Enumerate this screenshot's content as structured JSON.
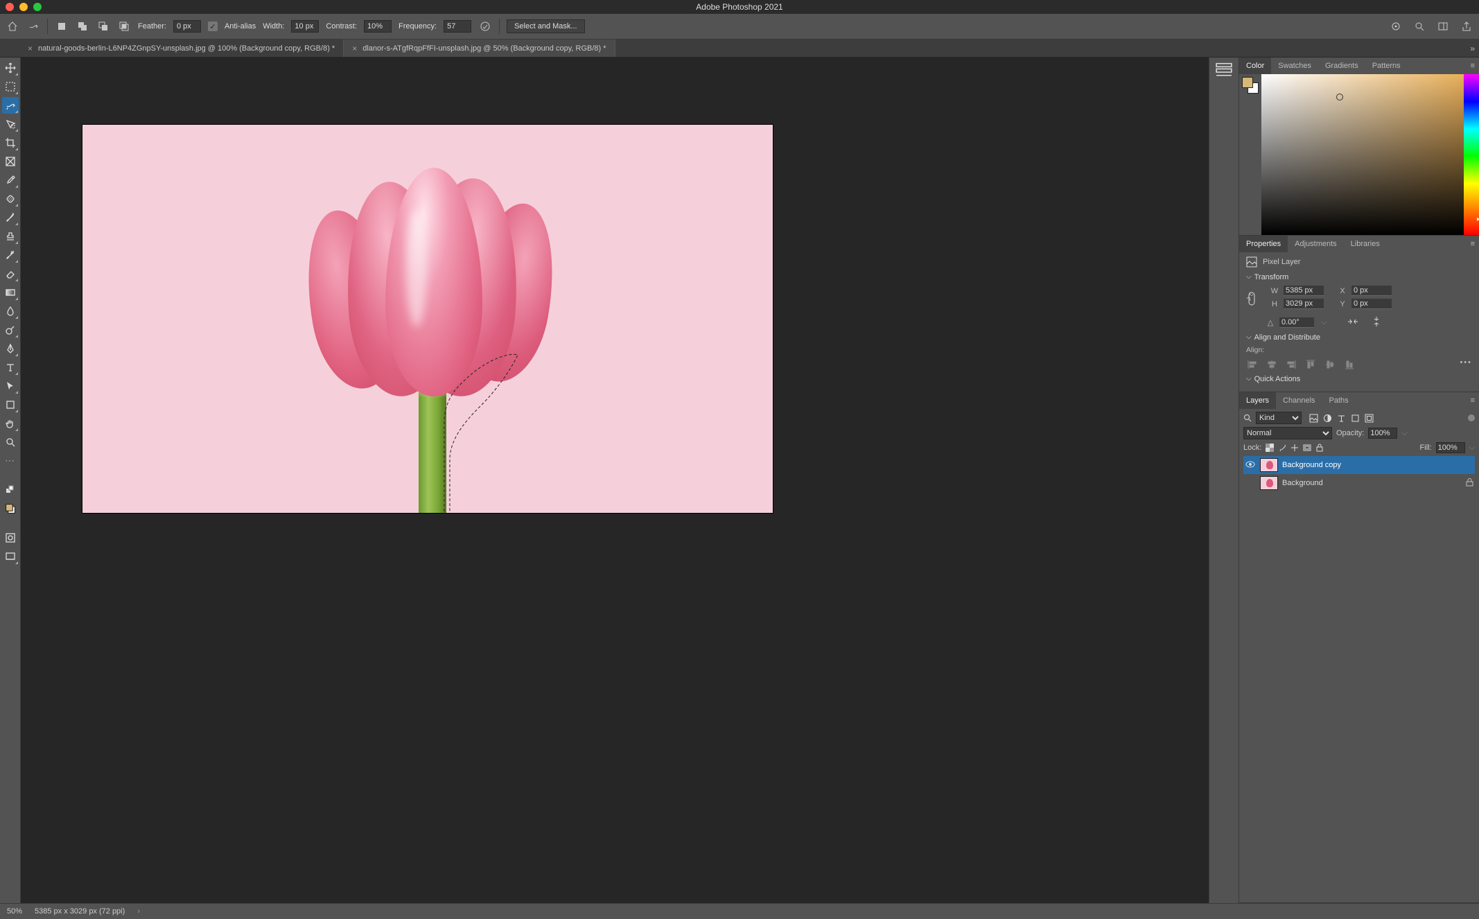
{
  "app_title": "Adobe Photoshop 2021",
  "options": {
    "feather_label": "Feather:",
    "feather_value": "0 px",
    "antialias_label": "Anti-alias",
    "antialias_checked": true,
    "width_label": "Width:",
    "width_value": "10 px",
    "contrast_label": "Contrast:",
    "contrast_value": "10%",
    "frequency_label": "Frequency:",
    "frequency_value": "57",
    "select_mask": "Select and Mask..."
  },
  "tabs": [
    {
      "close": "×",
      "label": "natural-goods-berlin-L6NP4ZGnpSY-unsplash.jpg @ 100% (Background copy, RGB/8) *",
      "active": false
    },
    {
      "close": "×",
      "label": "dlanor-s-ATgfRqpFfFI-unsplash.jpg @ 50% (Background copy, RGB/8) *",
      "active": true
    }
  ],
  "color_panel": {
    "tabs": [
      "Color",
      "Swatches",
      "Gradients",
      "Patterns"
    ],
    "active": 0,
    "fgcolor": "#d7b878",
    "bgcolor": "#ffffff"
  },
  "properties_panel": {
    "tabs": [
      "Properties",
      "Adjustments",
      "Libraries"
    ],
    "active": 0,
    "layer_type": "Pixel Layer",
    "transform_title": "Transform",
    "W_label": "W",
    "H_label": "H",
    "X_label": "X",
    "Y_label": "Y",
    "W": "5385 px",
    "H": "3029 px",
    "X": "0 px",
    "Y": "0 px",
    "angle_label": "⊿",
    "angle": "0.00°",
    "align_title": "Align and Distribute",
    "align_sub": "Align:",
    "quick_title": "Quick Actions"
  },
  "layers_panel": {
    "tabs": [
      "Layers",
      "Channels",
      "Paths"
    ],
    "active": 0,
    "kind_label": "Kind",
    "blend_label": "Normal",
    "opacity_label": "Opacity:",
    "opacity": "100%",
    "lock_label": "Lock:",
    "fill_label": "Fill:",
    "fill": "100%",
    "layers": [
      {
        "name": "Background copy",
        "visible": true,
        "locked": false,
        "active": true
      },
      {
        "name": "Background",
        "visible": false,
        "locked": true,
        "active": false
      }
    ]
  },
  "status": {
    "zoom": "50%",
    "docinfo": "5385 px x 3029 px (72 ppi)",
    "arrow": "›"
  }
}
